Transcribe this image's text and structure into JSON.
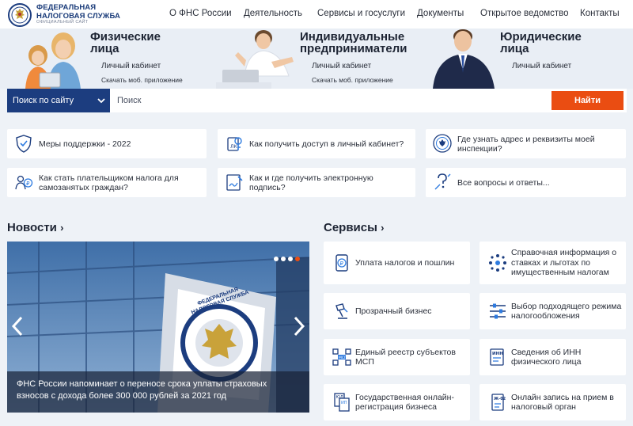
{
  "brand": {
    "line1": "ФЕДЕРАЛЬНАЯ",
    "line2": "НАЛОГОВАЯ СЛУЖБА",
    "line3": "ОФИЦИАЛЬНЫЙ САЙТ"
  },
  "nav": [
    "О ФНС России",
    "Деятельность",
    "Сервисы и госуслуги",
    "Документы",
    "Открытое ведомство",
    "Контакты"
  ],
  "hero": [
    {
      "title1": "Физические",
      "title2": "лица",
      "link": "Личный кабинет",
      "app": "Скачать моб. приложение"
    },
    {
      "title1": "Индивидуальные",
      "title2": "предприниматели",
      "link": "Личный кабинет",
      "app": "Скачать моб. приложение"
    },
    {
      "title1": "Юридические",
      "title2": "лица",
      "link": "Личный кабинет",
      "app": ""
    }
  ],
  "search": {
    "scope": "Поиск по сайту",
    "placeholder": "Поиск",
    "button": "Найти"
  },
  "quick": [
    "Меры поддержки - 2022",
    "Как получить доступ в личный кабинет?",
    "Где узнать адрес и реквизиты моей инспекции?",
    "Как стать плательщиком налога для самозанятых граждан?",
    "Как и где получить электронную подпись?",
    "Все вопросы и ответы..."
  ],
  "news": {
    "heading": "Новости",
    "caption": "ФНС России напоминает о переносе срока уплаты страховых взносов с дохода более 300 000 рублей за 2021 год",
    "sign_text": "ФЕДЕРАЛЬНАЯ НАЛОГОВАЯ СЛУЖБА",
    "slides": 4,
    "active_slide": 4
  },
  "services": {
    "heading": "Сервисы",
    "items": [
      "Уплата налогов и пошлин",
      "Справочная информация о ставках и льготах по имущественным налогам",
      "Прозрачный бизнес",
      "Выбор подходящего режима налогообложения",
      "Единый реестр субъектов МСП",
      "Сведения об ИНН физического лица",
      "Государственная онлайн-регистрация бизнеса",
      "Онлайн запись на прием в налоговый орган"
    ]
  },
  "colors": {
    "primary": "#1c3d7f",
    "accent": "#ea4d12",
    "bg": "#eef2f7"
  }
}
